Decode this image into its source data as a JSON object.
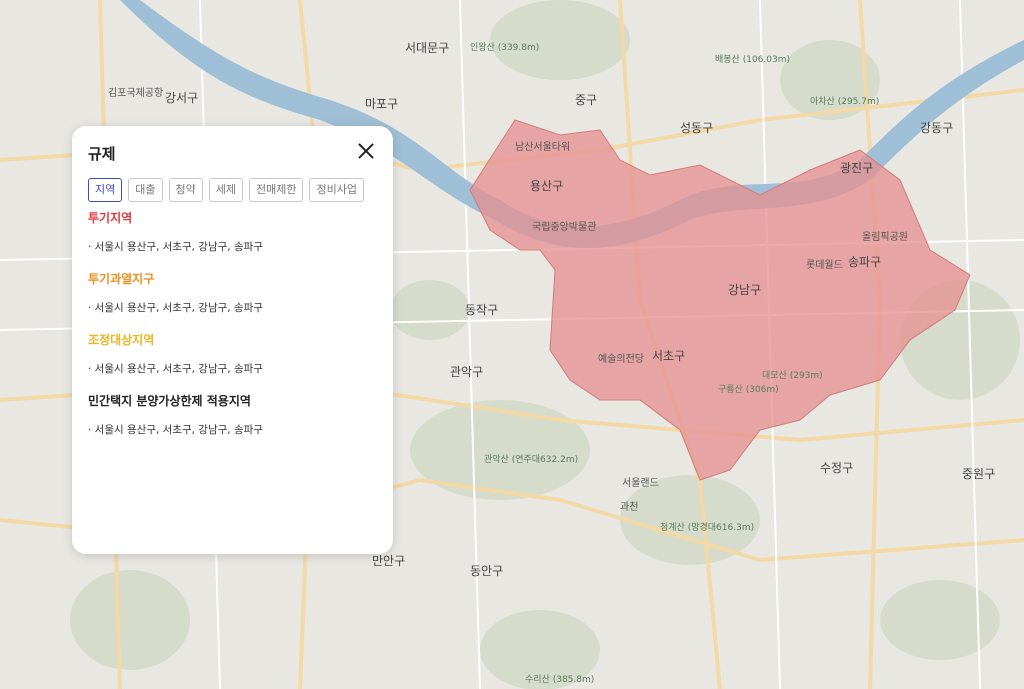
{
  "map": {
    "labels": {
      "seodaemun": "서대문구",
      "mapo": "마포구",
      "gangseo": "강서구",
      "yongsan": "용산구",
      "jung": "중구",
      "seongdong": "성동구",
      "gwangjin": "광진구",
      "gangdong": "강동구",
      "songpa": "송파구",
      "gangnam": "강남구",
      "seocho": "서초구",
      "dongjak": "동작구",
      "gwanak": "관악구",
      "sujeong": "수정구",
      "jungwon": "중원구",
      "gwacheon": "과천",
      "anyang": "만안구",
      "dongan": "동안구",
      "namsan": "남산서울타워",
      "museum": "국립중앙박물관",
      "olympic": "올림픽공원",
      "lotte": "롯데월드",
      "arts": "예술의전당",
      "seoulland": "서울랜드",
      "gimpo": "김포국제공항",
      "inwang": "인왕산 (339.8m)",
      "achasan": "아차산 (295.7m)",
      "baebong": "배봉산 (106.03m)",
      "daemo": "대모산 (293m)",
      "guryong": "구룡산 (306m)",
      "gwanaksan": "관악산 (연주대632.2m)",
      "cheonggye": "청계산 (망경대616.3m)",
      "suri": "수리산 (385.8m)"
    }
  },
  "panel": {
    "title": "규제",
    "tabs": [
      {
        "label": "지역",
        "active": true
      },
      {
        "label": "대출",
        "active": false
      },
      {
        "label": "청약",
        "active": false
      },
      {
        "label": "세제",
        "active": false
      },
      {
        "label": "전매제한",
        "active": false
      },
      {
        "label": "정비사업",
        "active": false
      }
    ],
    "sections": [
      {
        "title": "투기지역",
        "color": "#e03a3a",
        "item": "· 서울시 용산구, 서초구, 강남구, 송파구"
      },
      {
        "title": "투기과열지구",
        "color": "#f0901e",
        "item": "· 서울시 용산구, 서초구, 강남구, 송파구"
      },
      {
        "title": "조정대상지역",
        "color": "#f0b41e",
        "item": "· 서울시 용산구, 서초구, 강남구, 송파구"
      },
      {
        "title": "민간택지 분양가상한제 적용지역",
        "color": "#222222",
        "item": "· 서울시 용산구, 서초구, 강남구, 송파구"
      }
    ]
  },
  "colors": {
    "region_fill": "#e58f8f",
    "river": "#7aa9c9",
    "accent": "#3a4cc4"
  }
}
